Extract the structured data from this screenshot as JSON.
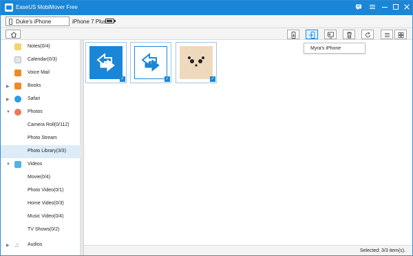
{
  "app": {
    "title": "EaseUS MobiMover Free"
  },
  "titlebar_icons": [
    "feedback-icon",
    "menu-icon",
    "minimize-icon",
    "maximize-icon",
    "close-icon"
  ],
  "device": {
    "selected": "Duke's iPhone",
    "model": "iPhone 7 Plus"
  },
  "popup": {
    "label": "Myra's iPhone"
  },
  "sidebar": {
    "items": [
      {
        "label": "Notes(0/4)",
        "icon": "notes-icon",
        "color": "#f5d26b"
      },
      {
        "label": "Calendar(0/3)",
        "icon": "calendar-icon",
        "color": "#e5e5e5"
      },
      {
        "label": "Voice Mail",
        "icon": "voicemail-icon",
        "color": "#f08a24"
      },
      {
        "label": "Books",
        "icon": "books-icon",
        "color": "#f08a24"
      },
      {
        "label": "Safari",
        "icon": "safari-icon",
        "color": "#2c9be8"
      },
      {
        "label": "Photos",
        "icon": "photos-icon",
        "color": "#e8795a"
      },
      {
        "label": "Camera Roll(0/112)"
      },
      {
        "label": "Photo Stream"
      },
      {
        "label": "Photo Library(3/3)"
      },
      {
        "label": "Videos",
        "icon": "videos-icon",
        "color": "#4fb3e8"
      },
      {
        "label": "Movie(0/4)"
      },
      {
        "label": "Photo Video(0/1)"
      },
      {
        "label": "Home Video(0/3)"
      },
      {
        "label": "Music Video(0/4)"
      },
      {
        "label": "TV Shows(0/2)"
      },
      {
        "label": "Audios",
        "icon": "music-icon",
        "color": "#999999"
      }
    ]
  },
  "status": {
    "selected": "Selected: 3/3 item(s)."
  },
  "colors": {
    "accent": "#1a86d8",
    "selection": "#dcecf9",
    "panda_bg": "#efd9bd"
  }
}
